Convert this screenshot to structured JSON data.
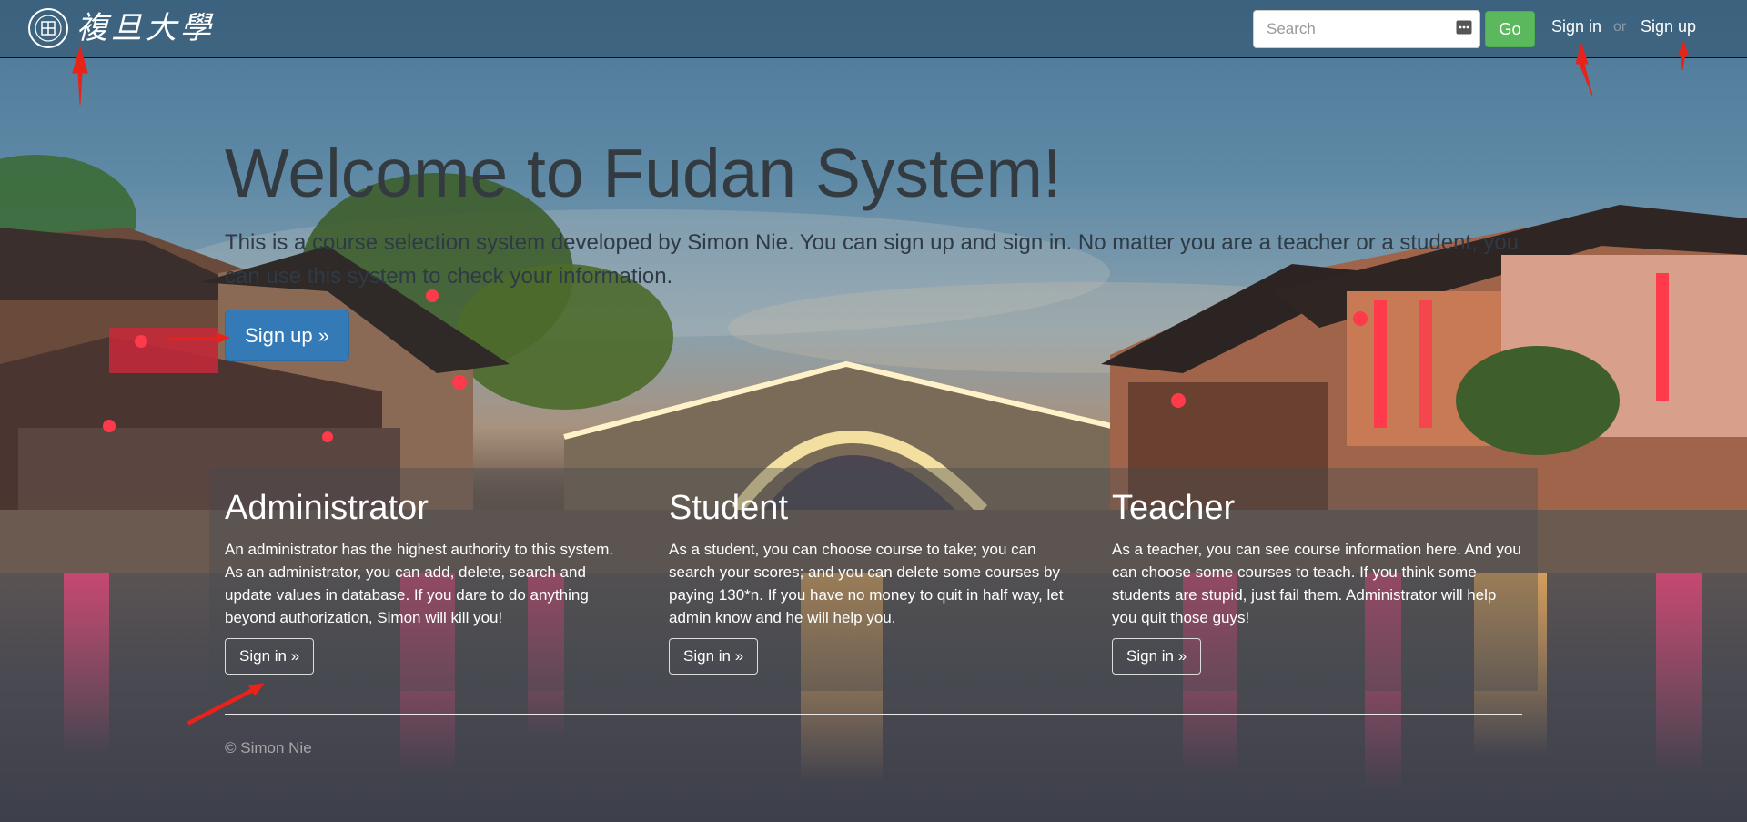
{
  "brand": {
    "logo_text": "複旦大學"
  },
  "nav": {
    "search_placeholder": "Search",
    "go_label": "Go",
    "sign_in_label": "Sign in",
    "or_label": "or",
    "sign_up_label": "Sign up"
  },
  "jumbotron": {
    "title": "Welcome to Fudan System!",
    "text": "This is a course selection system developed by Simon Nie. You can sign up and sign in. No matter you are a teacher or a student, you can use this system to check your information.",
    "button_label": "Sign up »"
  },
  "features": [
    {
      "title": "Administrator",
      "text": "An administrator has the highest authority to this system. As an administrator, you can add, delete, search and update values in database. If you dare to do anything beyond authorization, Simon will kill you!",
      "button_label": "Sign in »"
    },
    {
      "title": "Student",
      "text": "As a student, you can choose course to take; you can search your scores; and you can delete some courses by paying 130*n. If you have no money to quit in half way, let admin know and he will help you.",
      "button_label": "Sign in »"
    },
    {
      "title": "Teacher",
      "text": "As a teacher, you can see course information here. And you can choose some courses to teach. If you think some students are stupid, just fail them. Administrator will help you quit those guys!",
      "button_label": "Sign in »"
    }
  ],
  "footer": {
    "copyright": "© Simon Nie"
  },
  "colors": {
    "primary": "#337ab7",
    "success": "#5cb85c",
    "annotation": "#e8231a"
  }
}
